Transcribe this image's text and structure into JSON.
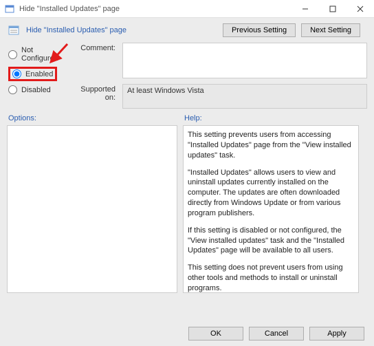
{
  "window": {
    "title": "Hide \"Installed Updates\" page"
  },
  "header": {
    "policy_title": "Hide \"Installed Updates\" page"
  },
  "nav": {
    "prev": "Previous Setting",
    "next": "Next Setting"
  },
  "radios": {
    "not_configured": "Not Configured",
    "enabled": "Enabled",
    "disabled": "Disabled",
    "selected": "enabled"
  },
  "labels": {
    "comment": "Comment:",
    "supported": "Supported on:"
  },
  "fields": {
    "comment_value": "",
    "supported_value": "At least Windows Vista"
  },
  "sections": {
    "options": "Options:",
    "help": "Help:"
  },
  "help": {
    "p1": "This setting prevents users from accessing \"Installed Updates\" page from the \"View installed updates\" task.",
    "p2": "\"Installed Updates\" allows users to view and uninstall updates currently installed on the computer.  The updates are often downloaded directly from Windows Update or from various program publishers.",
    "p3": "If this setting is disabled or not configured, the \"View installed updates\" task and the \"Installed Updates\" page will be available to all users.",
    "p4": "This setting does not prevent users from using other tools and methods to install or uninstall programs."
  },
  "footer": {
    "ok": "OK",
    "cancel": "Cancel",
    "apply": "Apply"
  }
}
